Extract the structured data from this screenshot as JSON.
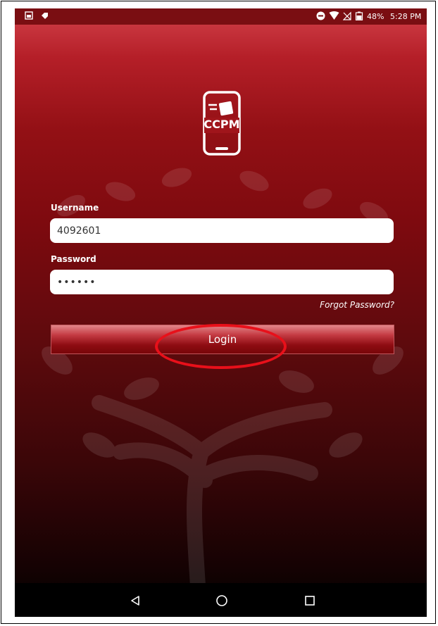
{
  "status_bar": {
    "battery_percent": "48%",
    "time": "5:28 PM"
  },
  "app": {
    "logo_text": "CCPM"
  },
  "form": {
    "username_label": "Username",
    "username_value": "4092601",
    "password_label": "Password",
    "password_value": "••••••",
    "forgot_password": "Forgot Password?",
    "login_button": "Login"
  },
  "colors": {
    "brand_red": "#931015",
    "annotation_circle": "#e8101a"
  }
}
